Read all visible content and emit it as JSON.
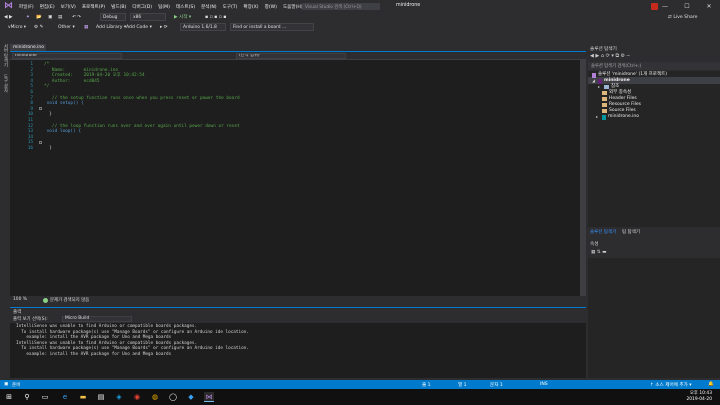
{
  "titlebar": {
    "menu": [
      "파일(F)",
      "편집(E)",
      "보기(V)",
      "프로젝트(P)",
      "빌드(B)",
      "디버그(D)",
      "팀(M)",
      "테스트(S)",
      "분석(N)",
      "도구(T)",
      "확장(X)",
      "창(W)",
      "도움말(H)"
    ],
    "search_placeholder": "Visual Studio 검색 (Ctrl+Q)",
    "solution_name": "minidrone"
  },
  "toolbar1": {
    "config": "Debug",
    "platform": "x86",
    "start_label": "▶ 시작 ▾",
    "live_share": "Live Share"
  },
  "toolbar2": {
    "project_combo": "vMicro ▾",
    "other_label": "Other ▾",
    "add_library": "Add Library ▾",
    "add_code": "Add Code ▾",
    "board_combo": "Arduino 1.6/1.8",
    "board_search": "Find or install a board ..."
  },
  "leftstrip": {
    "tab1": "서버 탐색기",
    "tab2": "도구 상자"
  },
  "editor": {
    "tab_label": "minidrone.ino",
    "nav_left": "minidrone",
    "nav_right": "(전역 범위)",
    "line_numbers": [
      "1",
      "2",
      "3",
      "4",
      "5",
      "6",
      "7",
      "8",
      "9",
      "10",
      "11",
      "12",
      "13",
      "14",
      "15",
      "16"
    ],
    "lines": [
      {
        "t": "/*",
        "c": "c"
      },
      {
        "t": "   Name:       minidrone.ino",
        "c": "c"
      },
      {
        "t": "   Created:    2019-04-20 오후 10:42:54",
        "c": "c"
      },
      {
        "t": "   Author:     ecd045",
        "c": "c"
      },
      {
        "t": "*/",
        "c": "c"
      },
      {
        "t": "",
        "c": ""
      },
      {
        "t": "   // the setup function runs once when you press reset or power the board",
        "c": "c"
      },
      {
        "t": " void setup() {",
        "c": "k"
      },
      {
        "t": "",
        "c": ""
      },
      {
        "t": "  }",
        "c": ""
      },
      {
        "t": "",
        "c": ""
      },
      {
        "t": "   // the loop function runs over and over again until power down or reset",
        "c": "c"
      },
      {
        "t": " void loop() {",
        "c": "k"
      },
      {
        "t": "",
        "c": ""
      },
      {
        "t": "",
        "c": ""
      },
      {
        "t": "  }",
        "c": ""
      }
    ],
    "zoom": "100 %",
    "issues": "문제가 검색되지 않음"
  },
  "output": {
    "title": "출력",
    "source_label": "출력 보기 선택(S):",
    "source_value": "Micro Build",
    "lines": [
      "IntelliSense was unable to find Arduino or compatible boards packages.",
      "  To install hardware package(s) use \"Manage Boards\" or configure an Arduino ide location.",
      "    example: install the AVR package for Uno and Mega boards",
      "IntelliSense was unable to find Arduino or compatible boards packages.",
      "  To install hardware package(s) use \"Manage Boards\" or configure an Arduino ide location.",
      "    example: install the AVR package for Uno and Mega boards"
    ]
  },
  "solution_explorer": {
    "title": "솔루션 탐색기",
    "search_placeholder": "솔루션 탐색기 검색(Ctrl+;)",
    "solution_node": "솔루션 'minidrone' (1개 프로젝트)",
    "project_node": "minidrone",
    "nodes": [
      "참조",
      "외부 종속성",
      "Header Files",
      "Resource Files",
      "Source Files",
      "minidrone.ino"
    ],
    "tab_solution": "솔루션 탐색기",
    "tab_team": "팀 탐색기"
  },
  "properties": {
    "title": "속성"
  },
  "statusbar": {
    "ready": "준비",
    "line": "줄 1",
    "col": "열 1",
    "char": "문자 1",
    "ins": "INS",
    "source_control": "↑ 소스 제어에 추가 ▾"
  },
  "taskbar": {
    "time": "오후 10:43",
    "date": "2019-04-20"
  },
  "colors": {
    "accent": "#007acc",
    "comment": "#57a64a",
    "keyword": "#569cd6"
  }
}
